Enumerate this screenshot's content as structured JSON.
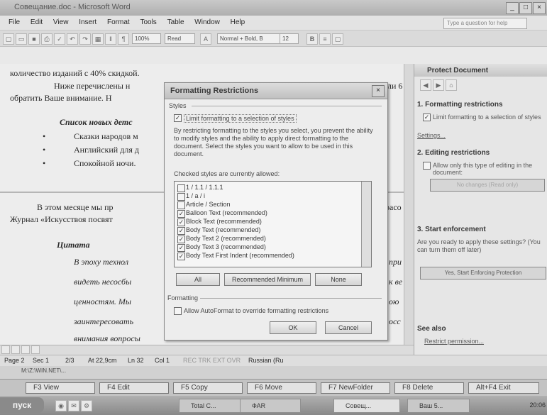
{
  "window": {
    "title": "Совещание.doc - Microsoft Word"
  },
  "menu": [
    "File",
    "Edit",
    "View",
    "Insert",
    "Format",
    "Tools",
    "Table",
    "Window",
    "Help"
  ],
  "ask_placeholder": "Type a question for help",
  "toolbar": {
    "zoom": "100%",
    "read": "Read",
    "style": "Normal + Bold, B",
    "size": "12"
  },
  "document": {
    "line1": "количество изданий с 40% скидкой.",
    "line2": "Ниже перечислены н",
    "line2_end": "ли 6",
    "line3": "обратить Ваше внимание. Н",
    "list_title": "Список новых детс",
    "bullets": [
      "Сказки народов м",
      "Английский для д",
      "Спокойной ночи."
    ],
    "para2_a": "В этом месяце мы пр",
    "para2_a_end": "расо",
    "para2_b": "Журнал «Искусствоя посвят",
    "quote_title": "Цитата",
    "quote_lines": [
      "В эпоху технол",
      "видеть несосбы",
      "ценностям. Мы",
      "заинтересовать",
      "внимания вопросы"
    ],
    "quote_ends": [
      "при",
      "к ве",
      "ою",
      "осс",
      ""
    ]
  },
  "dialog": {
    "title": "Formatting Restrictions",
    "styles_group": "Styles",
    "limit_label": "Limit formatting to a selection of styles",
    "description": "By restricting formatting to the styles you select, you prevent the ability to modify styles and the ability to apply direct formatting to the document. Select the styles you want to allow to be used in this document.",
    "checked_label": "Checked styles are currently allowed:",
    "styles": [
      {
        "name": "1 / 1.1 / 1.1.1",
        "checked": false
      },
      {
        "name": "1 / a / i",
        "checked": false
      },
      {
        "name": "Article / Section",
        "checked": false
      },
      {
        "name": "Balloon Text (recommended)",
        "checked": true
      },
      {
        "name": "Block Text (recommended)",
        "checked": true
      },
      {
        "name": "Body Text (recommended)",
        "checked": true
      },
      {
        "name": "Body Text 2 (recommended)",
        "checked": true
      },
      {
        "name": "Body Text 3 (recommended)",
        "checked": true
      },
      {
        "name": "Body Text First Indent (recommended)",
        "checked": true
      }
    ],
    "btn_all": "All",
    "btn_recommended": "Recommended Minimum",
    "btn_none": "None",
    "formatting_group": "Formatting",
    "autoformat_label": "Allow AutoFormat to override formatting restrictions",
    "ok": "OK",
    "cancel": "Cancel"
  },
  "pane": {
    "title": "Protect Document",
    "h1": "1. Formatting restrictions",
    "h1_check": "Limit formatting to a selection of styles",
    "settings": "Settings...",
    "h2": "2. Editing restrictions",
    "h2_check": "Allow only this type of editing in the document:",
    "h2_select": "No changes (Read only)",
    "h3": "3. Start enforcement",
    "h3_text": "Are you ready to apply these settings? (You can turn them off later)",
    "h3_btn": "Yes, Start Enforcing Protection",
    "see_also": "See also",
    "restrict": "Restrict permission..."
  },
  "status": {
    "page": "Page 2",
    "sec": "Sec 1",
    "pos": "2/3",
    "at": "At 22,9cm",
    "ln": "Ln 32",
    "col": "Col 1",
    "modes": "REC TRK EXT OVR",
    "lang": "Russian (Ru"
  },
  "far": {
    "path": "M:\\Z:\\WIN.NET\\...",
    "keys": [
      {
        "n": "F3",
        "label": "View"
      },
      {
        "n": "F4",
        "label": "Edit"
      },
      {
        "n": "F5",
        "label": "Copy"
      },
      {
        "n": "F6",
        "label": "Move"
      },
      {
        "n": "F7",
        "label": "NewFolder"
      },
      {
        "n": "F8",
        "label": "Delete"
      },
      {
        "n": "",
        "label": "Alt+F4 Exit"
      }
    ]
  },
  "taskbar": {
    "start": "пуск",
    "tasks": [
      "Total C...",
      "ФАR",
      "Совещ...",
      "Ваш 5..."
    ],
    "clock": "20:06"
  }
}
